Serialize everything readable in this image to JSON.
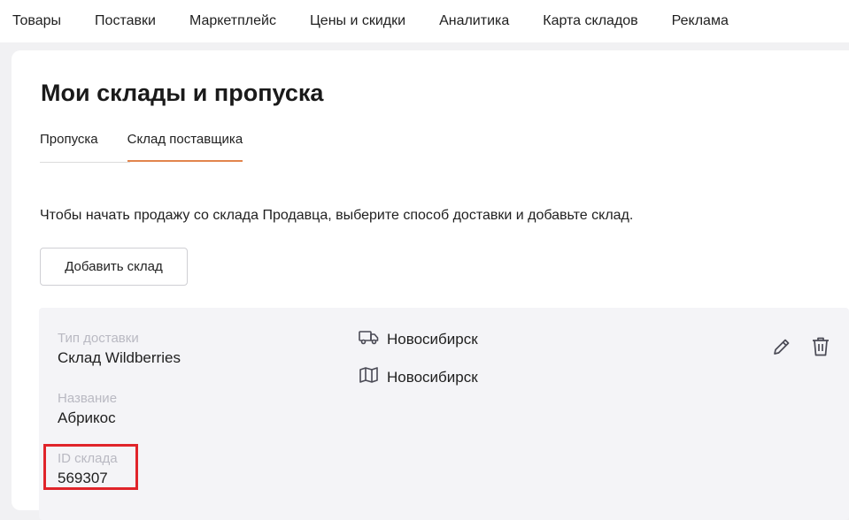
{
  "topnav": {
    "items": [
      {
        "label": "Товары"
      },
      {
        "label": "Поставки"
      },
      {
        "label": "Маркетплейс"
      },
      {
        "label": "Цены и скидки"
      },
      {
        "label": "Аналитика"
      },
      {
        "label": "Карта складов"
      },
      {
        "label": "Реклама"
      }
    ]
  },
  "page": {
    "title": "Мои склады и пропуска",
    "tabs": [
      {
        "label": "Пропуска",
        "active": false
      },
      {
        "label": "Склад поставщика",
        "active": true
      }
    ],
    "hint": "Чтобы начать продажу со склада Продавца, выберите способ доставки и добавьте склад.",
    "add_button_label": "Добавить склад"
  },
  "warehouse": {
    "delivery_type_label": "Тип доставки",
    "delivery_type_value": "Склад Wildberries",
    "name_label": "Название",
    "name_value": "Абрикос",
    "id_label": "ID склада",
    "id_value": "569307",
    "delivery_city": "Новосибирск",
    "map_city": "Новосибирск",
    "icons": {
      "delivery": "truck-icon",
      "map": "map-icon",
      "edit": "pencil-icon",
      "delete": "trash-icon"
    }
  },
  "colors": {
    "accent_tab_underline": "#e2854d",
    "highlight_box": "#e0242a"
  }
}
